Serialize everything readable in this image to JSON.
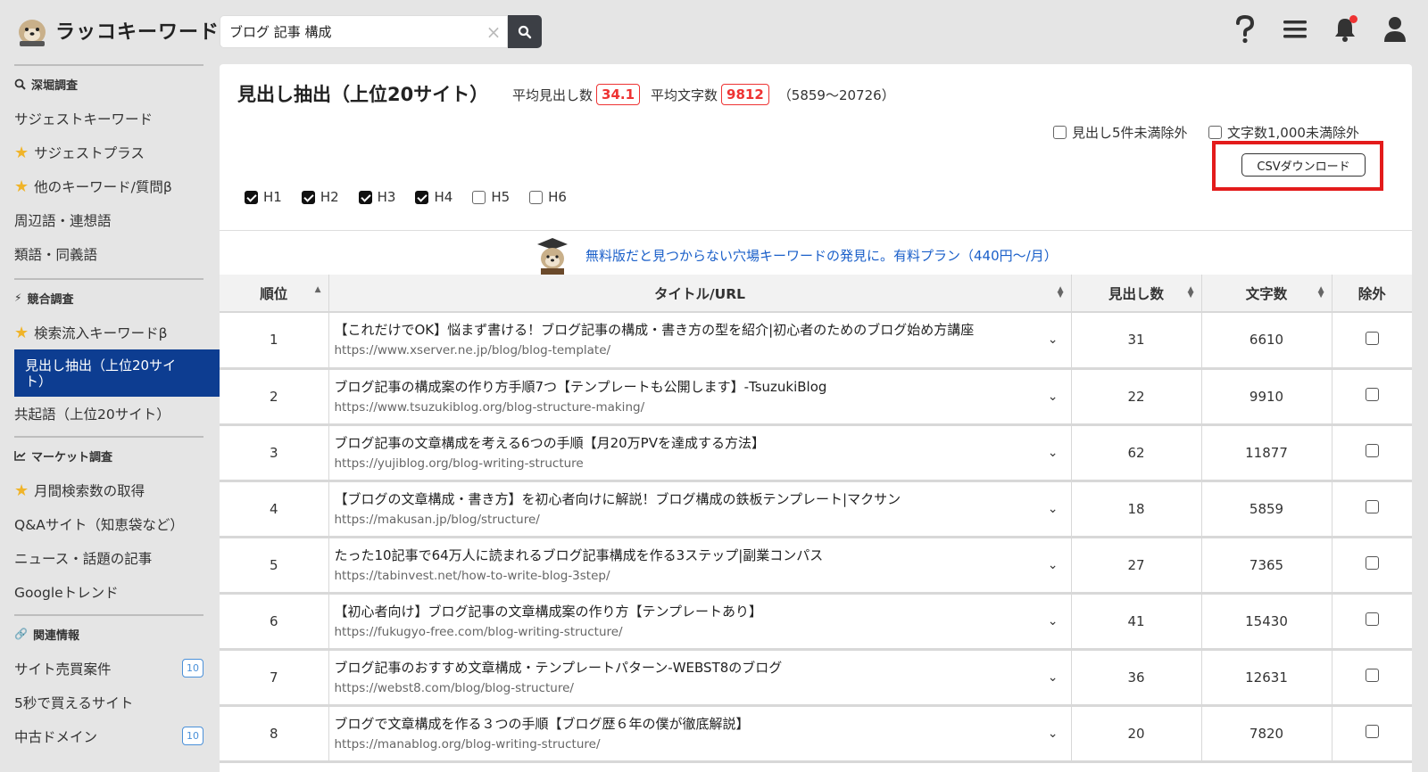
{
  "app": {
    "name": "ラッコキーワード"
  },
  "search": {
    "value": "ブログ 記事 構成",
    "clear": "×"
  },
  "sidebar": {
    "sections": [
      {
        "label": "深堀調査",
        "items": [
          {
            "label": "サジェストキーワード",
            "star": false
          },
          {
            "label": "サジェストプラス",
            "star": true
          },
          {
            "label": "他のキーワード/質問β",
            "star": true
          },
          {
            "label": "周辺語・連想語",
            "star": false
          },
          {
            "label": "類語・同義語",
            "star": false
          }
        ]
      },
      {
        "label": "競合調査",
        "items": [
          {
            "label": "検索流入キーワードβ",
            "star": true
          },
          {
            "label": "見出し抽出（上位20サイト）",
            "star": false,
            "active": true
          },
          {
            "label": "共起語（上位20サイト）",
            "star": false
          }
        ]
      },
      {
        "label": "マーケット調査",
        "items": [
          {
            "label": "月間検索数の取得",
            "star": true
          },
          {
            "label": "Q&Aサイト（知恵袋など）",
            "star": false
          },
          {
            "label": "ニュース・話題の記事",
            "star": false
          },
          {
            "label": "Googleトレンド",
            "star": false
          }
        ]
      },
      {
        "label": "関連情報",
        "items": [
          {
            "label": "サイト売買案件",
            "badge": "10"
          },
          {
            "label": "5秒で買えるサイト"
          },
          {
            "label": "中古ドメイン",
            "badge": "10"
          }
        ]
      }
    ]
  },
  "main": {
    "title": "見出し抽出（上位20サイト）",
    "avg_headings_label": "平均見出し数",
    "avg_headings": "34.1",
    "avg_chars_label": "平均文字数",
    "avg_chars": "9812",
    "range": "（5859〜20726）",
    "exclude_headings": "見出し5件未満除外",
    "exclude_chars": "文字数1,000未満除外",
    "csv_label": "CSVダウンロード",
    "heading_filters": [
      {
        "label": "H1",
        "checked": true
      },
      {
        "label": "H2",
        "checked": true
      },
      {
        "label": "H3",
        "checked": true
      },
      {
        "label": "H4",
        "checked": true
      },
      {
        "label": "H5",
        "checked": false
      },
      {
        "label": "H6",
        "checked": false
      }
    ],
    "promo": "無料版だと見つからない穴場キーワードの発見に。有料プラン（440円〜/月）"
  },
  "table": {
    "headers": {
      "rank": "順位",
      "title": "タイトル/URL",
      "headings": "見出し数",
      "chars": "文字数",
      "exclude": "除外"
    },
    "rows": [
      {
        "rank": "1",
        "title": "【これだけでOK】悩まず書ける！ブログ記事の構成・書き方の型を紹介|初心者のためのブログ始め方講座",
        "url": "https://www.xserver.ne.jp/blog/blog-template/",
        "headings": "31",
        "chars": "6610"
      },
      {
        "rank": "2",
        "title": "ブログ記事の構成案の作り方手順7つ【テンプレートも公開します】-TsuzukiBlog",
        "url": "https://www.tsuzukiblog.org/blog-structure-making/",
        "headings": "22",
        "chars": "9910"
      },
      {
        "rank": "3",
        "title": "ブログ記事の文章構成を考える6つの手順【月20万PVを達成する方法】",
        "url": "https://yujiblog.org/blog-writing-structure",
        "headings": "62",
        "chars": "11877"
      },
      {
        "rank": "4",
        "title": "【ブログの文章構成・書き方】を初心者向けに解説！ブログ構成の鉄板テンプレート|マクサン",
        "url": "https://makusan.jp/blog/structure/",
        "headings": "18",
        "chars": "5859"
      },
      {
        "rank": "5",
        "title": "たった10記事で64万人に読まれるブログ記事構成を作る3ステップ|副業コンパス",
        "url": "https://tabinvest.net/how-to-write-blog-3step/",
        "headings": "27",
        "chars": "7365"
      },
      {
        "rank": "6",
        "title": "【初心者向け】ブログ記事の文章構成案の作り方【テンプレートあり】",
        "url": "https://fukugyo-free.com/blog-writing-structure/",
        "headings": "41",
        "chars": "15430"
      },
      {
        "rank": "7",
        "title": "ブログ記事のおすすめ文章構成・テンプレートパターン-WEBST8のブログ",
        "url": "https://webst8.com/blog/blog-structure/",
        "headings": "36",
        "chars": "12631"
      },
      {
        "rank": "8",
        "title": "ブログで文章構成を作る３つの手順【ブログ歴６年の僕が徹底解説】",
        "url": "https://manablog.org/blog-writing-structure/",
        "headings": "20",
        "chars": "7820"
      }
    ]
  },
  "colors": {
    "accent": "#0d3d91",
    "highlight": "#e31b1b",
    "stat": "#e33333",
    "link": "#1a5fc9"
  }
}
